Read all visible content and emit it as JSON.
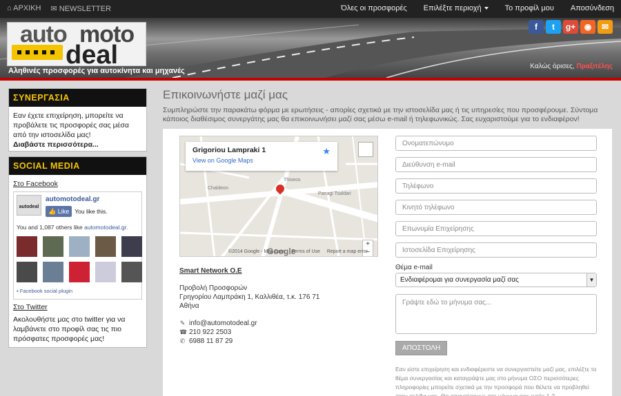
{
  "topnav": {
    "home_label": "ΑΡΧΙΚΗ",
    "newsletter_label": "NEWSLETTER",
    "all_offers": "Όλες οι προσφορές",
    "choose_area": "Επιλέξτε περιοχή",
    "profile": "Το προφίλ μου",
    "logout": "Αποσύνδεση"
  },
  "header": {
    "logo_auto": "auto",
    "logo_moto": "moto",
    "logo_deal": "deal",
    "tagline": "Αληθινές προσφορές για αυτοκίνητα και μηχανές",
    "welcome_text": "Καλώς όρισες,",
    "welcome_user": "Πραξιτέλης",
    "social_icons": [
      {
        "name": "facebook-icon",
        "glyph": "f",
        "color": "#3b5998"
      },
      {
        "name": "twitter-icon",
        "glyph": "t",
        "color": "#1da1f2"
      },
      {
        "name": "google-plus-icon",
        "glyph": "g+",
        "color": "#dd4b39"
      },
      {
        "name": "rss-icon",
        "glyph": "◉",
        "color": "#f26522"
      },
      {
        "name": "email-icon",
        "glyph": "✉",
        "color": "#f39c12"
      }
    ]
  },
  "sidebar": {
    "synergy": {
      "title": "ΣΥΝΕΡΓΑΣΙΑ",
      "text": "Εαν έχετε επιχείρηση, μπορείτε να προβάλετε τις προσφορές σας μέσα από την ιστοσελίδα μας!",
      "more": "Διαβάστε περισσότερα..."
    },
    "social": {
      "title": "SOCIAL MEDIA",
      "facebook_link": "Στο Facebook",
      "fb_page_name": "automotodeal.gr",
      "fb_like": "Like",
      "fb_you_like": "You like this.",
      "fb_others": "You and 1,087 others like",
      "fb_others_page": "automotodeal.gr.",
      "fb_plugin": "Facebook social plugin",
      "twitter_link": "Στο Twitter",
      "twitter_text": "Ακολουθήστε μας στο twitter για να λαμβάνετε στο προφίλ σας τις πιο πρόσφατες προσφορές μας!"
    }
  },
  "main": {
    "title": "Επικοινωνήστε μαζί μας",
    "intro": "Συμπληρώστε την παρακάτω φόρμα με ερωτήσεις - απορίες σχετικά με την ιστοσελίδα μας ή τις υπηρεσίες που προσφέρουμε. Σύντομα κάποιος διαθέσιμος συνεργάτης μας θα επικοινωνήσει μαζί σας μέσω e-mail ή τηλεφωνικώς. Σας ευχαριστούμε για το ενδιαφέρον!",
    "map": {
      "card_address": "Grigoriou Lampraki 1",
      "view_link": "View on Google Maps",
      "google_label": "Google",
      "copyright": "©2014 Google - Map Data",
      "terms": "Terms of Use",
      "report": "Report a map error",
      "zoom_in": "+",
      "zoom_out": "−"
    },
    "company": "Smart Network O.E",
    "address_lines": [
      "Προβολή Προσφορών",
      "Γρηγορίου Λαμπράκη 1, Καλλιθέα, τ.κ. 176 71",
      "Αθήνα"
    ],
    "email": "info@automotodeal.gr",
    "phone": "210 922 2503",
    "mobile": "6988 11 87 29",
    "form": {
      "name_ph": "Ονοματεπώνυμο",
      "email_ph": "Διεύθυνση e-mail",
      "phone_ph": "Τηλέφωνο",
      "mobile_ph": "Κινητό τηλέφωνο",
      "company_ph": "Επωνυμία Επιχείρησης",
      "website_ph": "Ιστοσελίδα Επιχείρησης",
      "subject_label": "Θέμα e-mail",
      "subject_value": "Ενδιαφέρομαι για συνεργασία μαζί σας",
      "message_ph": "Γράψτε εδώ το μήνυμα σας...",
      "submit": "ΑΠΟΣΤΟΛΗ",
      "note": "Εαν είστε επιχείρηση και ενδιαφέρεστε να συνεργαστείτε μαζί μας, επιλέξτε το θέμα συνεργασίας και καταγράψτε μας στο μήνυμα ΟΣΟ περισσότερες πληροφορίες μπορείτε σχετικά με την προσφορά που θέλετε να προβληθεί στην σελίδα μας. Θα απαντήσουμε στο μήνυμα σας εντός 1-2"
    }
  }
}
